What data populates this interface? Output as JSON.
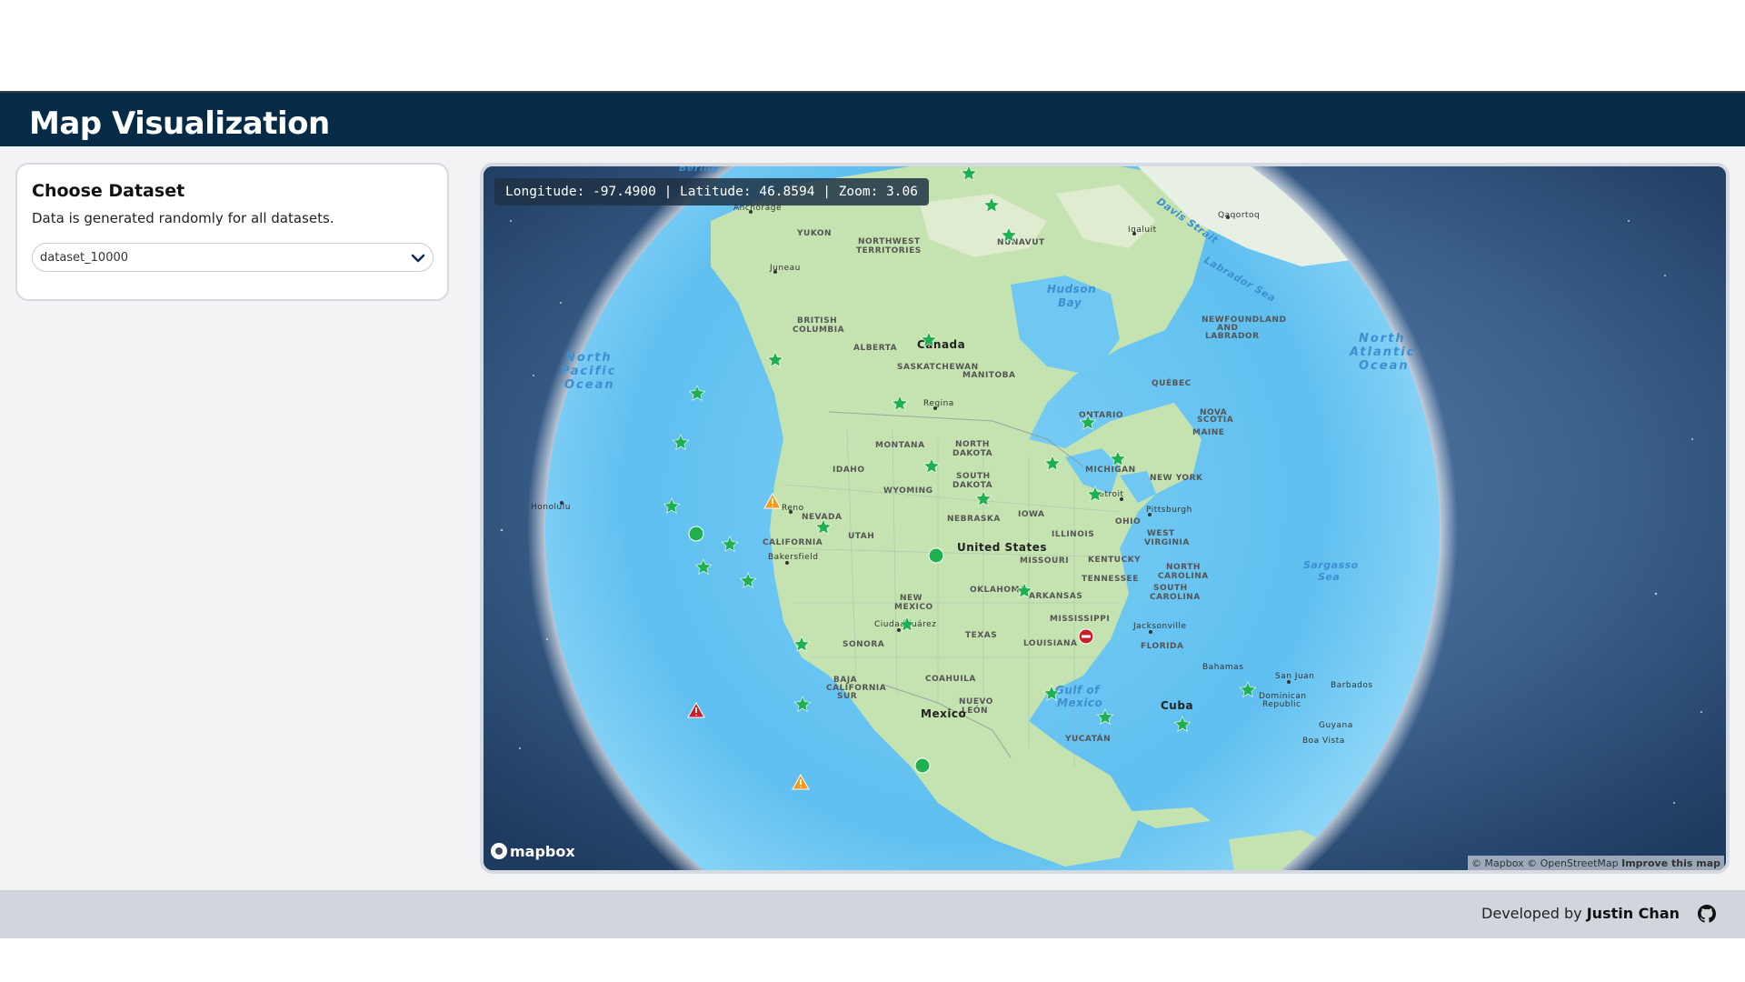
{
  "header": {
    "title": "Map Visualization"
  },
  "sidebar": {
    "card_title": "Choose Dataset",
    "card_description": "Data is generated randomly for all datasets.",
    "dataset_select": {
      "selected": "dataset_10000",
      "icon": "chevron-down-icon"
    }
  },
  "map": {
    "coords_text": "Longitude: -97.4900 | Latitude: 46.8594 | Zoom: 3.06",
    "logo_text": "mapbox",
    "attribution": {
      "mapbox": "© Mapbox",
      "osm": "© OpenStreetMap",
      "improve": "Improve this map"
    },
    "labels": {
      "bering": "Bering",
      "anchorage": "Anchorage",
      "yukon": "YUKON",
      "nwt1": "NORTHWEST",
      "nwt2": "TERRITORIES",
      "nunavut": "NUNAVUT",
      "qaqortoq": "Qaqortoq",
      "iqaluit": "Iqaluit",
      "davis": "Davis Strait",
      "labrador": "Labrador Sea",
      "hudson1": "Hudson",
      "hudson2": "Bay",
      "juneau": "Juneau",
      "bc1": "BRITISH",
      "bc2": "COLUMBIA",
      "alberta": "ALBERTA",
      "canada": "Canada",
      "sask": "SASKATCHEWAN",
      "manitoba": "MANITOBA",
      "regina": "Regina",
      "nfl1": "NEWFOUNDLAND",
      "nfl2": "AND",
      "nfl3": "LABRADOR",
      "quebec": "QUÉBEC",
      "ontario": "ONTARIO",
      "novascotia1": "NOVA",
      "novascotia2": "SCOTIA",
      "npo1": "North",
      "npo2": "Pacific",
      "npo3": "Ocean",
      "nao1": "North",
      "nao2": "Atlantic",
      "nao3": "Ocean",
      "montana": "MONTANA",
      "nd1": "NORTH",
      "nd2": "DAKOTA",
      "sd1": "SOUTH",
      "sd2": "DAKOTA",
      "idaho": "IDAHO",
      "wyoming": "WYOMING",
      "michigan": "MICHIGAN",
      "newyork": "NEW YORK",
      "maine": "MAINE",
      "honolulu": "Honolulu",
      "reno": "Reno",
      "nevada": "NEVADA",
      "nebraska": "NEBRASKA",
      "iowa": "IOWA",
      "detroit": "Detroit",
      "pittsburgh": "Pittsburgh",
      "ohio": "OHIO",
      "utah": "UTAH",
      "california": "CALIFORNIA",
      "illinois": "ILLINOIS",
      "wv1": "WEST",
      "wv2": "VIRGINIA",
      "unitedstates": "United States",
      "bakersfield": "Bakersfield",
      "missouri": "MISSOURI",
      "kentucky": "KENTUCKY",
      "nc1": "NORTH",
      "nc2": "CAROLINA",
      "tennessee": "TENNESSEE",
      "sc1": "SOUTH",
      "sc2": "CAROLINA",
      "sargasso1": "Sargasso",
      "sargasso2": "Sea",
      "oklahoma": "OKLAHOMA",
      "arkansas": "ARKANSAS",
      "nm1": "NEW",
      "nm2": "MEXICO",
      "mississippi": "MISSISSIPPI",
      "ciudadjuarez": "Ciudad Juárez",
      "jacksonville": "Jacksonville",
      "texas": "TEXAS",
      "louisiana": "LOUISIANA",
      "florida": "FLORIDA",
      "sonora": "SONORA",
      "bahamas": "Bahamas",
      "sanjuan": "San Juan",
      "barbados": "Barbados",
      "bcs1": "BAJA",
      "bcs2": "CALIFORNIA",
      "bcs3": "SUR",
      "coahuila": "COAHUILA",
      "gulf1": "Gulf of",
      "gulf2": "Mexico",
      "dr1": "Dominican",
      "dr2": "Republic",
      "nuevoleon1": "NUEVO",
      "nuevoleon2": "LEÓN",
      "cuba": "Cuba",
      "mexico": "Mexico",
      "guyana": "Guyana",
      "yucatan": "YUCATÁN",
      "boavista": "Boa Vista"
    }
  },
  "footer": {
    "prefix": "Developed by ",
    "author": "Justin Chan",
    "icon": "github-icon"
  },
  "colors": {
    "header_bg": "#052b47",
    "marker_green": "#1fb050",
    "marker_orange": "#f39a1e",
    "marker_red": "#cc1f2a"
  }
}
